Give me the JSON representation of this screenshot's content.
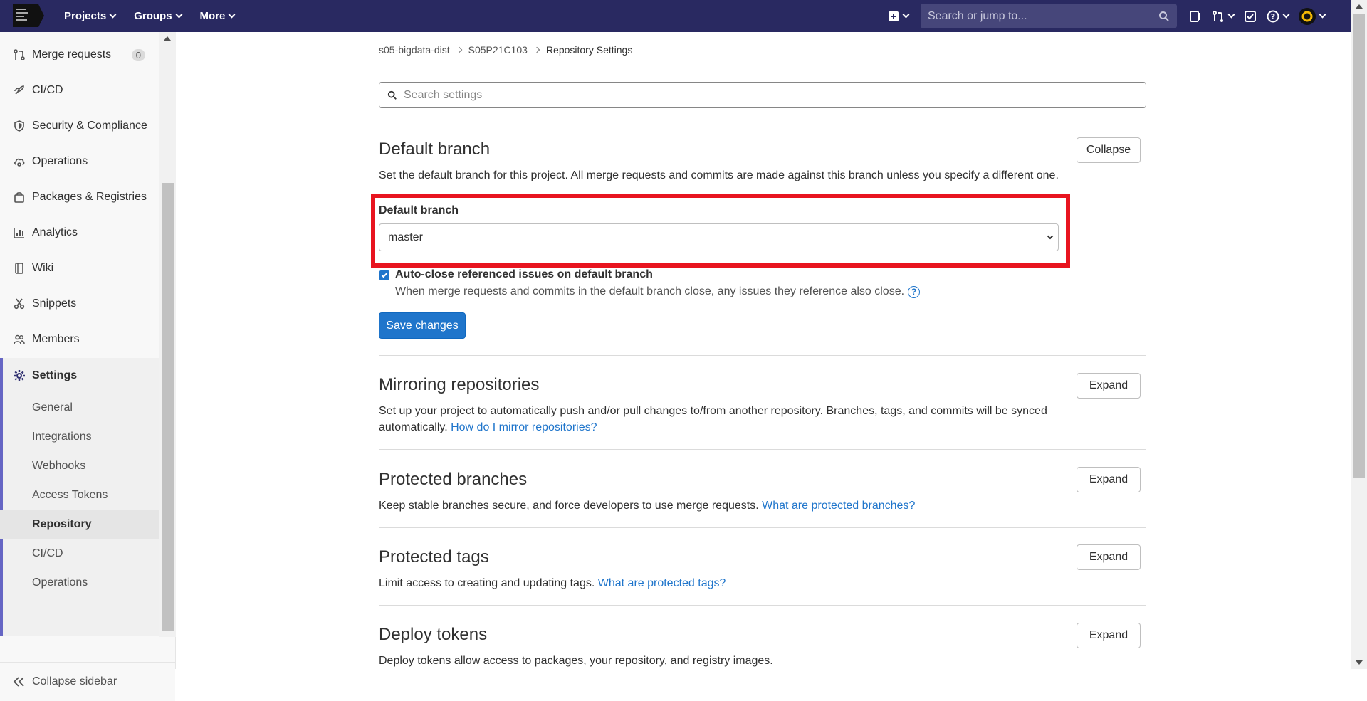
{
  "navbar": {
    "menus": [
      "Projects",
      "Groups",
      "More"
    ],
    "search_placeholder": "Search or jump to..."
  },
  "sidebar": {
    "items": [
      {
        "label": "Merge requests",
        "icon": "merge-request-icon",
        "badge": "0"
      },
      {
        "label": "CI/CD",
        "icon": "rocket-icon"
      },
      {
        "label": "Security & Compliance",
        "icon": "shield-icon"
      },
      {
        "label": "Operations",
        "icon": "cloud-gear-icon"
      },
      {
        "label": "Packages & Registries",
        "icon": "package-icon"
      },
      {
        "label": "Analytics",
        "icon": "chart-icon"
      },
      {
        "label": "Wiki",
        "icon": "book-icon"
      },
      {
        "label": "Snippets",
        "icon": "scissors-icon"
      },
      {
        "label": "Members",
        "icon": "users-icon"
      }
    ],
    "settings": {
      "label": "Settings",
      "sub_items": [
        "General",
        "Integrations",
        "Webhooks",
        "Access Tokens",
        "Repository",
        "CI/CD",
        "Operations"
      ],
      "current": "Repository"
    },
    "collapse_label": "Collapse sidebar"
  },
  "breadcrumb": [
    "s05-bigdata-dist",
    "S05P21C103",
    "Repository Settings"
  ],
  "search_settings_placeholder": "Search settings",
  "default_branch": {
    "title": "Default branch",
    "description": "Set the default branch for this project. All merge requests and commits are made against this branch unless you specify a different one.",
    "toggle_label": "Collapse",
    "field_label": "Default branch",
    "selected_value": "master",
    "checkbox_label": "Auto-close referenced issues on default branch",
    "checkbox_checked": true,
    "checkbox_help": "When merge requests and commits in the default branch close, any issues they reference also close.",
    "save_label": "Save changes"
  },
  "sections": [
    {
      "title": "Mirroring repositories",
      "description": "Set up your project to automatically push and/or pull changes to/from another repository. Branches, tags, and commits will be synced automatically.",
      "link": "How do I mirror repositories?",
      "button": "Expand"
    },
    {
      "title": "Protected branches",
      "description": "Keep stable branches secure, and force developers to use merge requests.",
      "link": "What are protected branches?",
      "button": "Expand"
    },
    {
      "title": "Protected tags",
      "description": "Limit access to creating and updating tags.",
      "link": "What are protected tags?",
      "button": "Expand"
    },
    {
      "title": "Deploy tokens",
      "description": "Deploy tokens allow access to packages, your repository, and registry images.",
      "link": "",
      "button": "Expand"
    }
  ],
  "colors": {
    "navbar": "#292961",
    "primary": "#1f75cb",
    "highlight": "#e8141f",
    "settings_accent": "#6666c4"
  }
}
